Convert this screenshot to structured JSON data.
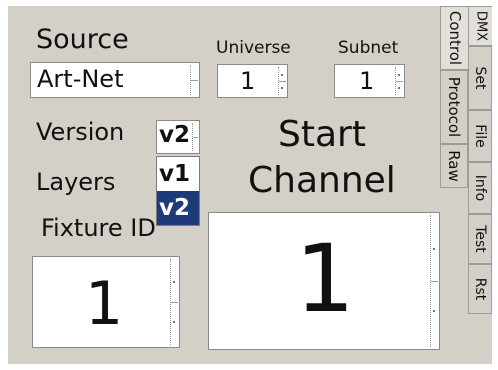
{
  "source": {
    "label": "Source",
    "value": "Art-Net"
  },
  "universe": {
    "label": "Universe",
    "value": "1"
  },
  "subnet": {
    "label": "Subnet",
    "value": "1"
  },
  "version": {
    "label": "Version",
    "selected": "v2",
    "options": [
      "v1",
      "v2"
    ],
    "highlighted_option": "v2",
    "highlight_color": "#1f3a7a"
  },
  "layers": {
    "label": "Layers"
  },
  "fixture_id": {
    "label": "Fixture ID",
    "value": "1"
  },
  "start_channel": {
    "label_line1": "Start",
    "label_line2": "Channel",
    "value": "1"
  },
  "inner_tabs": [
    "Control",
    "Protocol",
    "Raw"
  ],
  "outer_tabs": [
    "DMX",
    "Set",
    "File",
    "Info",
    "Test",
    "Rst"
  ]
}
